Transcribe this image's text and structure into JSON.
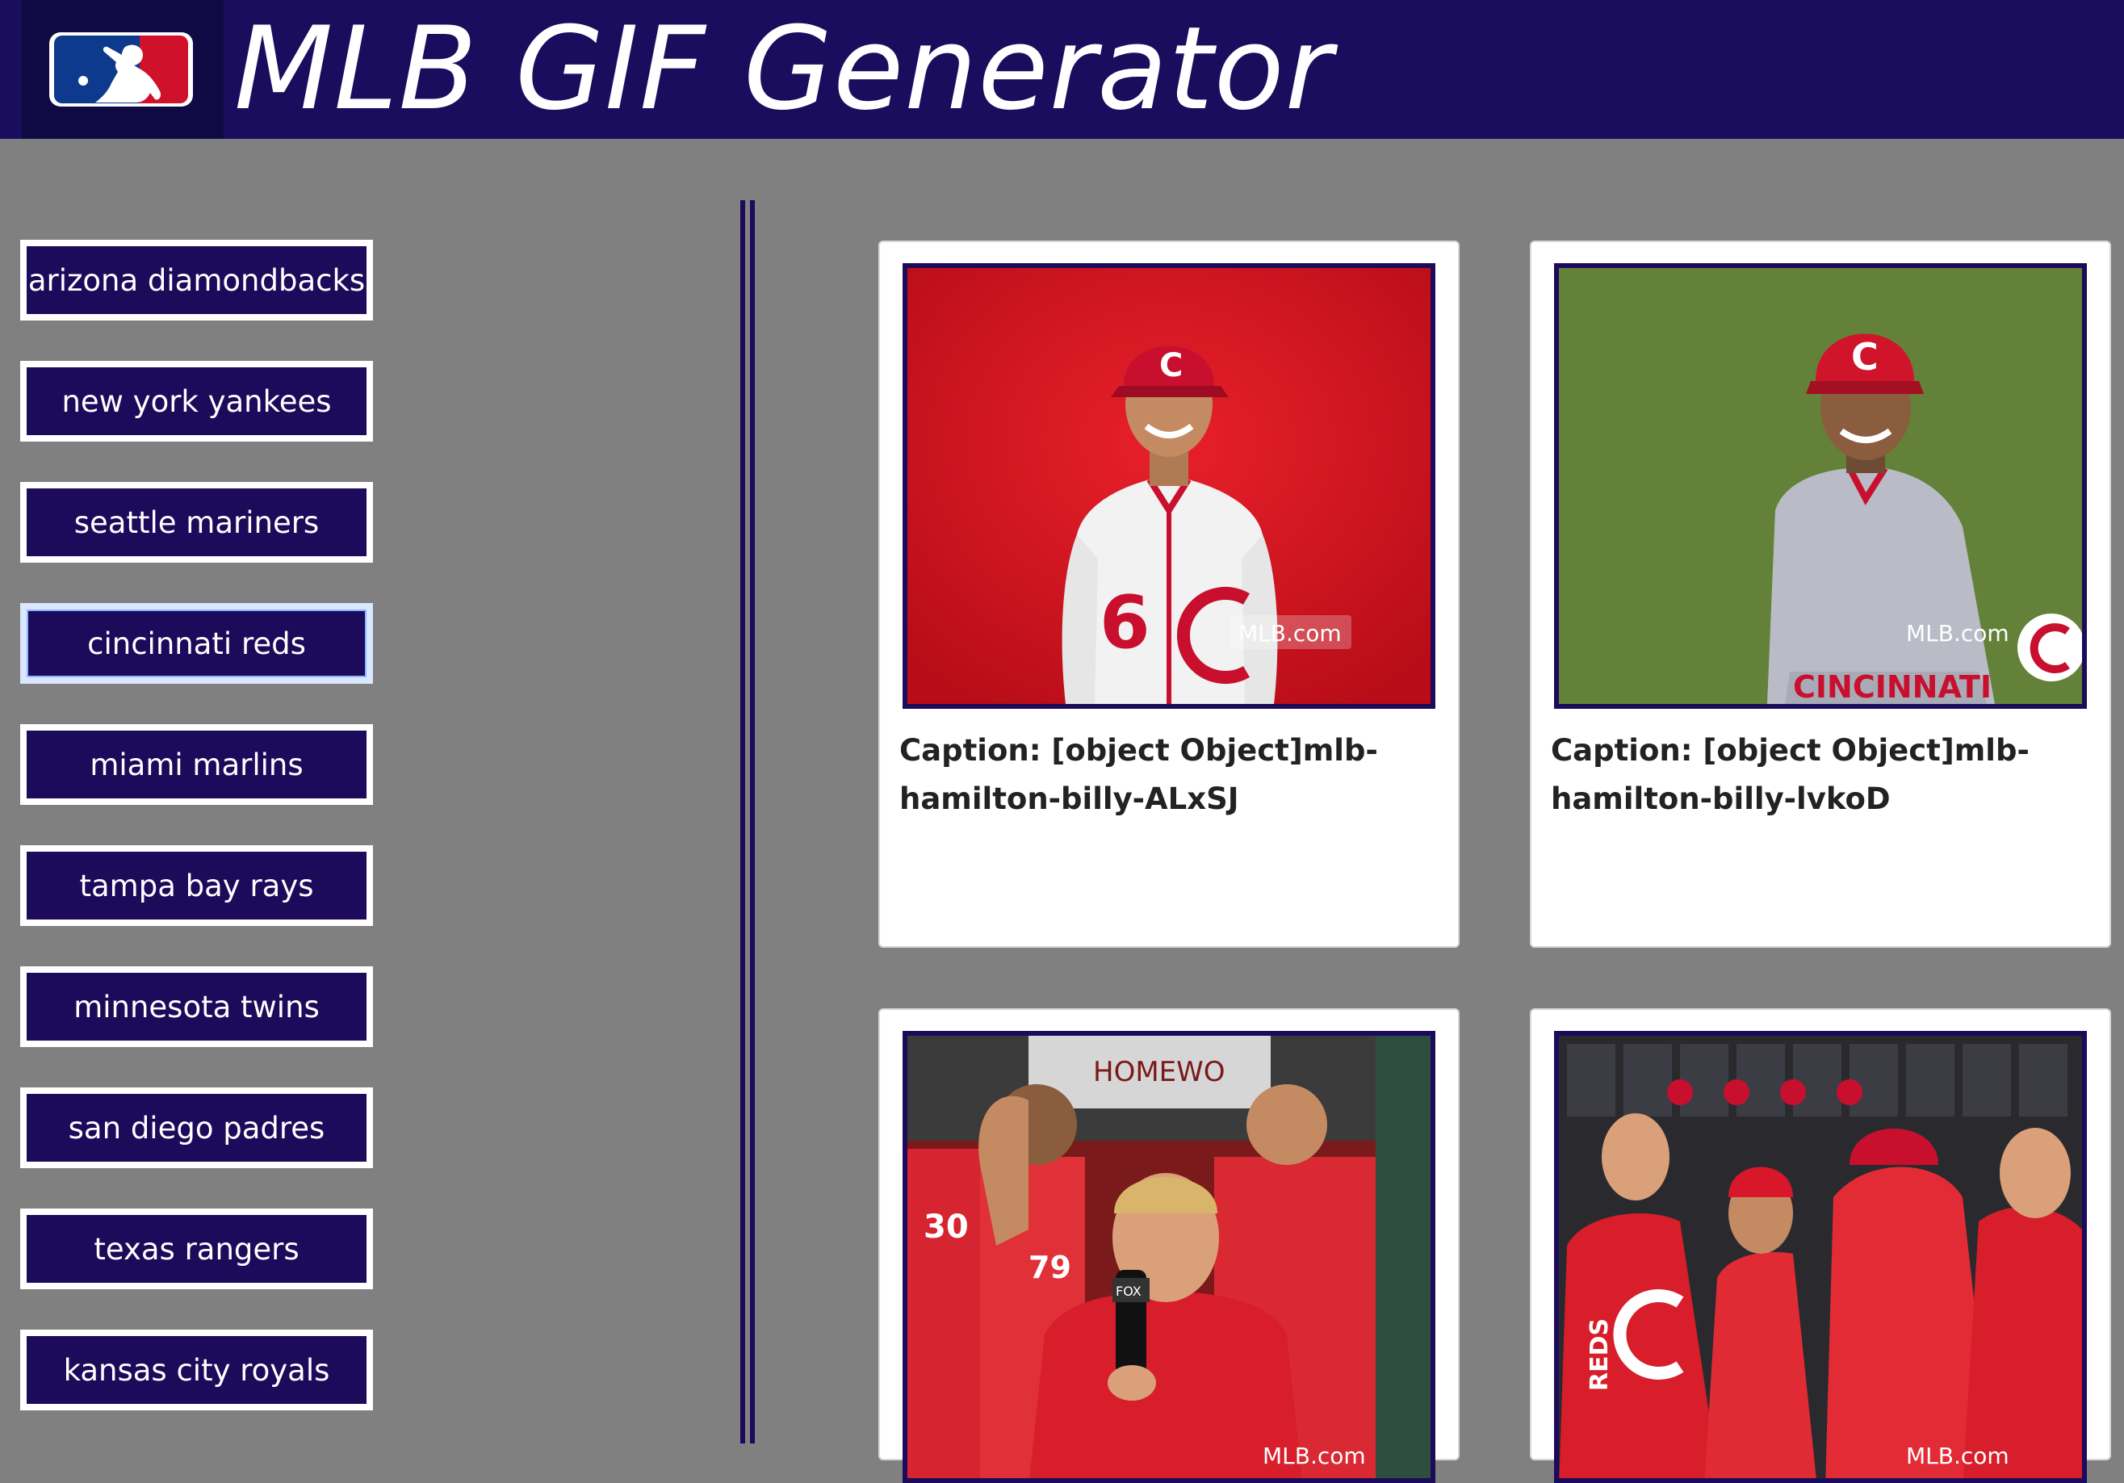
{
  "header": {
    "title": "MLB GIF Generator",
    "logo_icon": "mlb-logo-icon",
    "background": "#1a0d5e"
  },
  "sidebar": {
    "teams": [
      {
        "label": "arizona diamondbacks"
      },
      {
        "label": "new york yankees"
      },
      {
        "label": "seattle mariners"
      },
      {
        "label": "cincinnati reds",
        "focused": true
      },
      {
        "label": "miami marlins"
      },
      {
        "label": "tampa bay rays"
      },
      {
        "label": "minnesota twins"
      },
      {
        "label": "san diego padres"
      },
      {
        "label": "texas rangers"
      },
      {
        "label": "kansas city royals"
      }
    ],
    "button_color": "#1c0a5a"
  },
  "gifs": [
    {
      "caption": "Caption: [object Object]mlb-hamilton-billy-ALxSJ",
      "watermark": "MLB.com",
      "scene": "player-red-backdrop"
    },
    {
      "caption": "Caption: [object Object]mlb-hamilton-billy-lvkoD",
      "watermark": "MLB.com",
      "scene": "player-on-field"
    },
    {
      "caption": "",
      "watermark": "MLB.com",
      "scene": "dugout-interview",
      "jersey_numbers": [
        "30",
        "79"
      ],
      "banner_text": "HOMEWO"
    },
    {
      "caption": "",
      "watermark": "MLB.com",
      "scene": "dugout-celebration",
      "hoodie_text": "REDS"
    }
  ],
  "colors": {
    "page_background": "#808080",
    "card_background": "#ffffff",
    "reds_red": "#c8102e"
  }
}
